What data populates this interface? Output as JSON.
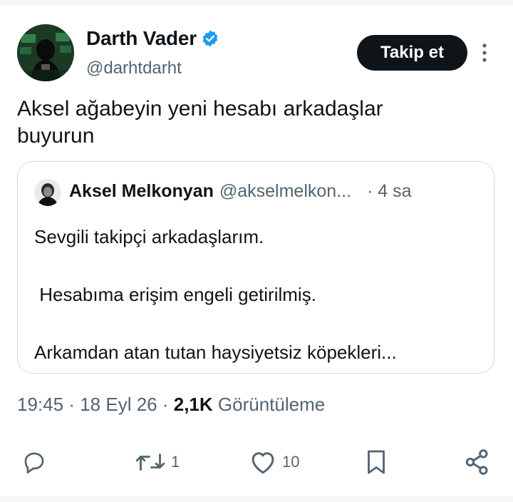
{
  "tweet": {
    "author": {
      "name": "Darth Vader",
      "handle": "@darhtdarht",
      "verified": true
    },
    "follow_label": "Takip et",
    "text": "Aksel ağabeyin yeni hesabı arkadaşlar\nbuyurun",
    "quoted": {
      "name": "Aksel Melkonyan",
      "handle": "@akselmelkon...",
      "time": "· 4 sa",
      "text": "Sevgili takipçi arkadaşlarım.\n\n Hesabıma erişim engeli getirilmiş.\n\nArkamdan atan tutan haysiyetsiz köpekleri..."
    },
    "meta": {
      "time": "19:45",
      "date": "18 Eyl 26",
      "views_count": "2,1K",
      "views_label": "Görüntüleme"
    },
    "actions": {
      "reply_count": "",
      "retweet_count": "1",
      "like_count": "10"
    }
  },
  "colors": {
    "text": "#0f1419",
    "secondary": "#536471",
    "verified": "#1d9bf0",
    "border": "#cfd9de",
    "button_bg": "#0f1419"
  },
  "icons": [
    "verified-badge-icon",
    "more-icon",
    "reply-icon",
    "retweet-icon",
    "like-icon",
    "bookmark-icon",
    "share-icon"
  ]
}
